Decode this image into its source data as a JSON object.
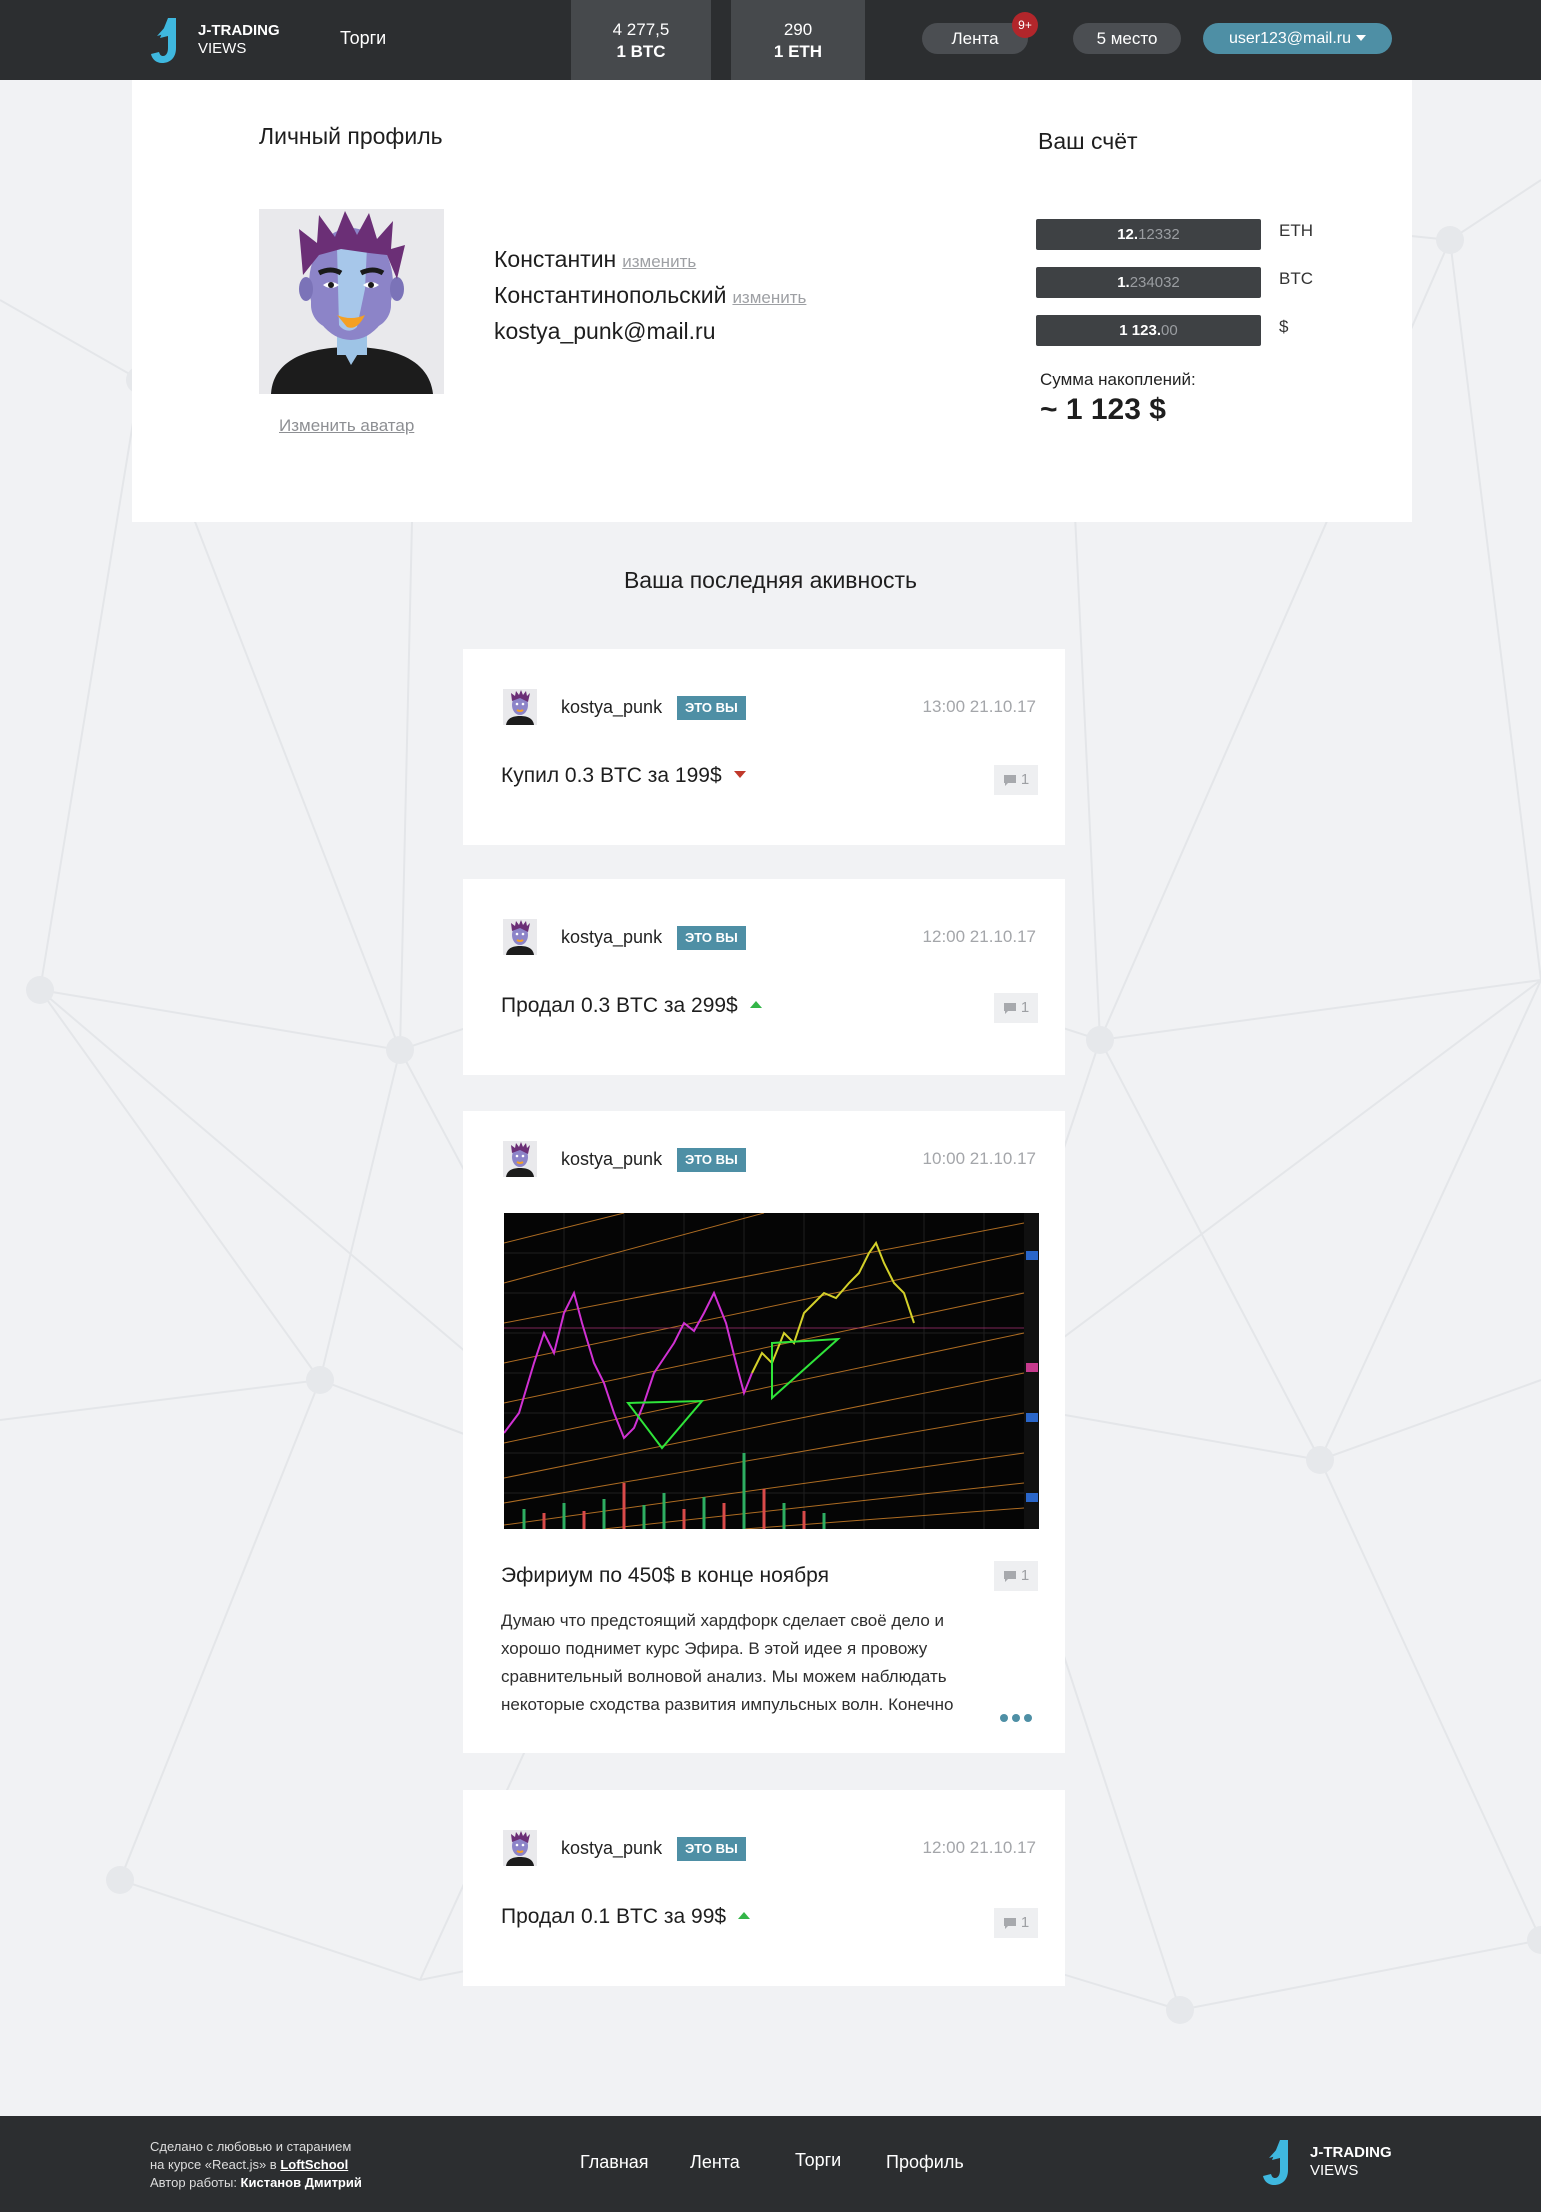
{
  "brand": {
    "line1": "J-TRADING",
    "line2": "VIEWS"
  },
  "header": {
    "nav_trade": "Торги",
    "rates": [
      {
        "value": "4 277,5",
        "unit": "1 BTC"
      },
      {
        "value": "290",
        "unit": "1 ETH"
      }
    ],
    "feed_label": "Лента",
    "feed_badge": "9+",
    "place_label": "5 место",
    "user_email": "user123@mail.ru"
  },
  "profile": {
    "title": "Личный профиль",
    "first_name": "Константин",
    "last_name": "Константинопольский",
    "edit_label": "изменить",
    "email": "kostya_punk@mail.ru",
    "change_avatar": "Изменить аватар"
  },
  "account": {
    "title": "Ваш счёт",
    "balances": [
      {
        "int": "12.",
        "dec": "12332",
        "currency": "ETH"
      },
      {
        "int": "1.",
        "dec": "234032",
        "currency": "BTC"
      },
      {
        "int": "1 123.",
        "dec": "00",
        "currency": "$"
      }
    ],
    "sum_label": "Сумма накоплений:",
    "sum_value": "~ 1 123 $"
  },
  "activity": {
    "title": "Ваша последняя акивность",
    "you_badge": "ЭТО ВЫ",
    "posts": [
      {
        "user": "kostya_punk",
        "time": "13:00 21.10.17",
        "text": "Купил 0.3 BTC за 199$",
        "direction": "down",
        "comments": "1"
      },
      {
        "user": "kostya_punk",
        "time": "12:00 21.10.17",
        "text": "Продал 0.3 BTC за 299$",
        "direction": "up",
        "comments": "1"
      },
      {
        "user": "kostya_punk",
        "time": "10:00 21.10.17",
        "title": "Эфириум по 450$ в конце ноября",
        "body": "Думаю что предстоящий хардфорк сделает своё дело и хорошо поднимет курс Эфира. В этой идее я провожу сравнительный волновой анализ. Мы можем наблюдать некоторые сходства развития импульсных волн. Конечно",
        "comments": "1"
      },
      {
        "user": "kostya_punk",
        "time": "12:00 21.10.17",
        "text": "Продал 0.1 BTC за 99$",
        "direction": "up",
        "comments": "1"
      }
    ]
  },
  "footer": {
    "credits_line1": "Сделано с любовью и старанием",
    "credits_line2_a": "на курсе «React.js» в ",
    "credits_school": "LoftSchool",
    "credits_line3_a": "Автор работы: ",
    "credits_author": "Кистанов Дмитрий",
    "nav": [
      "Главная",
      "Лента",
      "Торги",
      "Профиль"
    ]
  },
  "colors": {
    "header_bg": "#2c2e30",
    "accent": "#4e8fa5",
    "logo": "#3fb8df",
    "badge": "#b2262b",
    "up": "#33b548",
    "down": "#c0392b"
  }
}
